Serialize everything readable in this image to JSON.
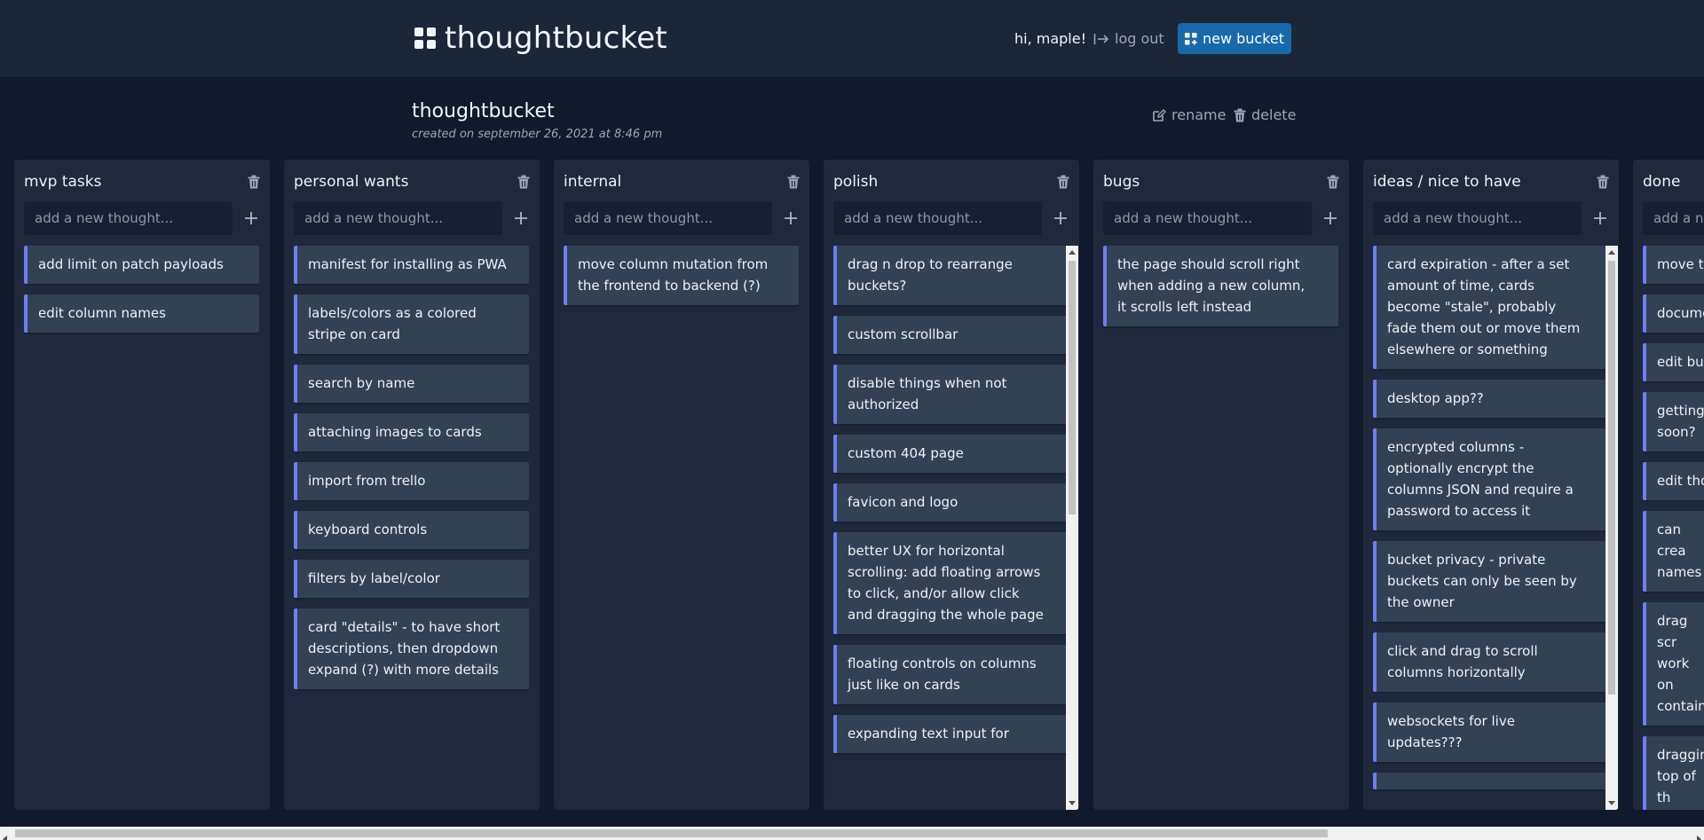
{
  "header": {
    "brand": "thoughtbucket",
    "greeting": "hi, maple!",
    "logout_label": "log out",
    "new_bucket_label": "new bucket"
  },
  "bucket": {
    "title": "thoughtbucket",
    "created": "created on september 26, 2021 at 8:46 pm",
    "rename_label": "rename",
    "delete_label": "delete"
  },
  "input_placeholder": "add a new thought...",
  "colors": {
    "background": "#111a2c",
    "column": "#1f293b",
    "card": "#334155",
    "accent": "#6f7df3",
    "button": "#1769aa"
  },
  "columns": [
    {
      "title": "mvp tasks",
      "cards": [
        "add limit on patch payloads",
        "edit column names"
      ]
    },
    {
      "title": "personal wants",
      "cards": [
        "manifest for installing as PWA",
        "labels/colors as a colored stripe on card",
        "search by name",
        "attaching images to cards",
        "import from trello",
        "keyboard controls",
        "filters by label/color",
        "card \"details\" - to have short descriptions, then dropdown expand (?) with more details"
      ]
    },
    {
      "title": "internal",
      "cards": [
        "move column mutation from the frontend to backend (?)"
      ]
    },
    {
      "title": "polish",
      "cards": [
        "drag n drop to rearrange buckets?",
        "custom scrollbar",
        "disable things when not authorized",
        "custom 404 page",
        "favicon and logo",
        "better UX for horizontal scrolling: add floating arrows to click, and/or allow click and dragging the whole page",
        "floating controls on columns just like on cards",
        "expanding text input for"
      ]
    },
    {
      "title": "bugs",
      "cards": [
        "the page should scroll right when adding a new column, it scrolls left instead"
      ]
    },
    {
      "title": "ideas / nice to have",
      "cards": [
        "card expiration - after a set amount of time, cards become \"stale\", probably fade them out or move them elsewhere or something",
        "desktop app??",
        "encrypted columns - optionally encrypt the columns JSON and require a password to access it",
        "bucket privacy - private buckets can only be seen by the owner",
        "click and drag to scroll columns horizontally",
        "websockets for live updates???",
        ""
      ]
    },
    {
      "title": "done",
      "cards": [
        "move to",
        "docume",
        "edit buc",
        "getting soon?",
        "edit tho",
        "can crea names",
        "drag scr work on containe",
        "dragging top of th already"
      ]
    }
  ]
}
